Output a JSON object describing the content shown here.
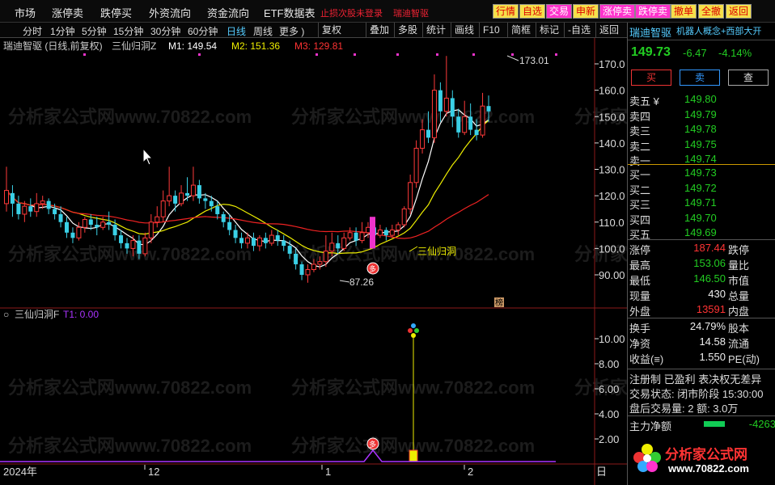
{
  "menu": [
    "市场",
    "涨停卖",
    "跌停买",
    "外资流向",
    "资金流向",
    "ETF数据表"
  ],
  "notice": [
    "止损次股未登录",
    "瑞迪智驱"
  ],
  "top_buttons": [
    "行情",
    "自选",
    "交易",
    "申新",
    "涨停卖",
    "跌停卖",
    "撤单",
    "全撤",
    "返回"
  ],
  "periods": [
    "分时",
    "1分钟",
    "5分钟",
    "15分钟",
    "30分钟",
    "60分钟",
    "日线",
    "周线",
    "更多 )"
  ],
  "tools": [
    "复权",
    "叠加",
    "多股",
    "统计",
    "画线",
    "F10",
    "简框",
    "标记",
    "-自选",
    "返回"
  ],
  "chart": {
    "stock_label": "瑞迪智驱 (日线,前复权)",
    "indicator_main": "三仙归洞Z",
    "m1": "M1: 149.54",
    "m2": "M2: 151.36",
    "m3": "M3: 129.81",
    "high_label": "173.01",
    "low_label": "87.26",
    "signal_label": "三仙归洞",
    "badge_text": "榜",
    "signal_icon": "多",
    "price_axis": [
      "170.0",
      "160.0",
      "150.0",
      "140.0",
      "130.0",
      "120.0",
      "110.0",
      "100.0",
      "90.00"
    ],
    "sub_indicator": "三仙归洞F",
    "t1": "T1: 0.00",
    "sub_axis": [
      "10.00",
      "8.00",
      "6.00",
      "4.00",
      "2.00"
    ],
    "x_labels": [
      "2024年",
      "12",
      "1",
      "2",
      "日"
    ],
    "watermark": "分析家公式网www.70822.com"
  },
  "panel": {
    "name": "瑞迪智驱",
    "concept": "机器人概念+西部大开",
    "price": "149.73",
    "change": "-6.47",
    "pct": "-4.14%",
    "btn_buy": "买",
    "btn_sell": "卖",
    "btn_query": "查",
    "asks": [
      {
        "label": "卖五 ¥",
        "price": "149.80",
        "qty": ""
      },
      {
        "label": "卖四",
        "price": "149.79",
        "qty": ""
      },
      {
        "label": "卖三",
        "price": "149.78",
        "qty": ""
      },
      {
        "label": "卖二",
        "price": "149.75",
        "qty": ""
      },
      {
        "label": "卖一",
        "price": "149.74",
        "qty": ""
      }
    ],
    "bids": [
      {
        "label": "买一",
        "price": "149.73",
        "qty": ""
      },
      {
        "label": "买二",
        "price": "149.72",
        "qty": ""
      },
      {
        "label": "买三",
        "price": "149.71",
        "qty": ""
      },
      {
        "label": "买四",
        "price": "149.70",
        "qty": ""
      },
      {
        "label": "买五",
        "price": "149.69",
        "qty": ""
      }
    ],
    "stats": [
      {
        "l": "涨停",
        "v": "187.44",
        "r": "跌停",
        "c": "red"
      },
      {
        "l": "最高",
        "v": "153.06",
        "r": "量比",
        "c": "green"
      },
      {
        "l": "最低",
        "v": "146.50",
        "r": "市值",
        "c": "green"
      },
      {
        "l": "现量",
        "v": "430",
        "r": "总量",
        "c": "white"
      },
      {
        "l": "外盘",
        "v": "13591",
        "r": "内盘",
        "c": "red"
      }
    ],
    "stats2": [
      {
        "l": "换手",
        "v": "24.79%",
        "r": "股本"
      },
      {
        "l": "净资",
        "v": "14.58",
        "r": "流通"
      },
      {
        "l": "收益(≡)",
        "v": "1.550",
        "r": "PE(动)"
      }
    ],
    "reg": "注册制 已盈利 表决权无差异",
    "trade_state": "交易状态: 闭市阶段 15:30:00",
    "after_hours": "盘后交易量: 2   额: 3.0万",
    "main_net_label": "主力净额",
    "main_net_value": "-4263",
    "logo_text": "分析家公式网",
    "logo_url": "www.70822.com"
  }
}
